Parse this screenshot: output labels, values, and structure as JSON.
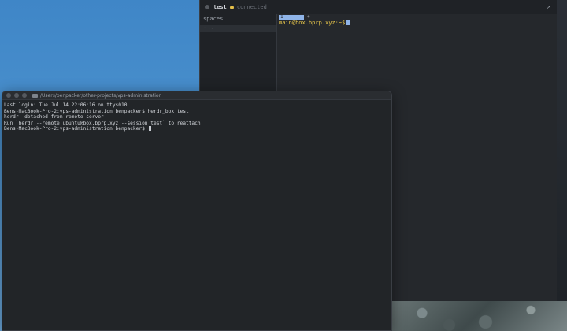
{
  "herdr": {
    "tab_name": "test",
    "status": "connected",
    "pin_icon": "pin-icon",
    "sidebar": {
      "heading": "spaces",
      "items": [
        {
          "marker": "·",
          "label": "~"
        }
      ]
    },
    "pane": {
      "tab_label": "1",
      "add_label": "+",
      "prompt": "main@box.bprp.xyz:~$"
    },
    "colors": {
      "status_dot": "#e5c04a",
      "prompt": "#e8c64a",
      "accent": "#8fb4e8"
    }
  },
  "terminal": {
    "title": "/Users/benpacker/other-projects/vps-administration",
    "lines": [
      "Last login: Tue Jul 14 22:06:16 on ttys010",
      "Bens-MacBook-Pro-2:vps-administration benpacker$ herdr_box test",
      "herdr: detached from remote server",
      "Run `herdr --remote ubuntu@box.bprp.xyz --session test` to reattach"
    ],
    "prompt": "Bens-MacBook-Pro-2:vps-administration benpacker$ "
  }
}
